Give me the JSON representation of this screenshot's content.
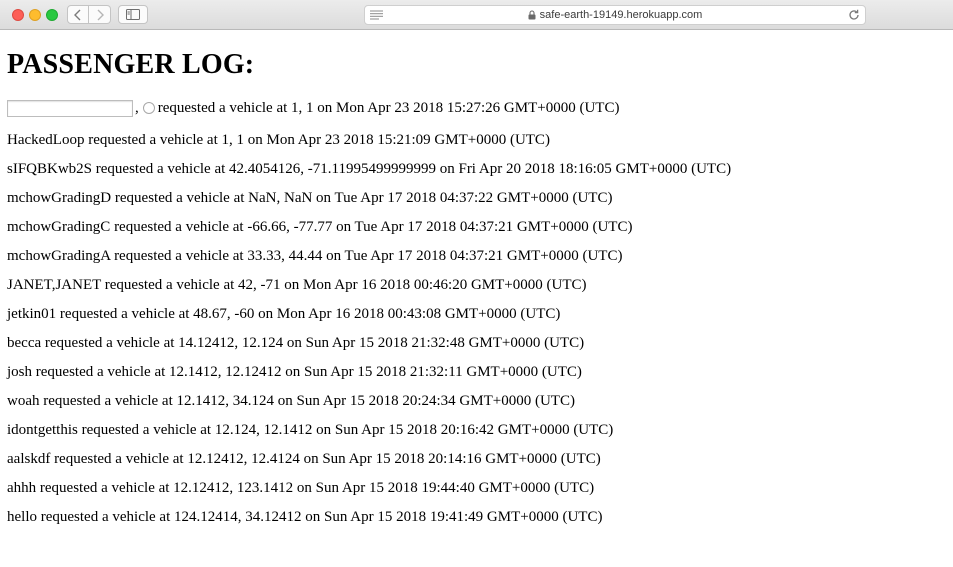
{
  "browser": {
    "url": "safe-earth-19149.herokuapp.com"
  },
  "page": {
    "title": "PASSENGER LOG:",
    "form": {
      "name_value": "",
      "comma": ",",
      "text": "requested a vehicle at 1, 1 on Mon Apr 23 2018 15:27:26 GMT+0000 (UTC)"
    },
    "entries": [
      "HackedLoop requested a vehicle at 1, 1 on Mon Apr 23 2018 15:21:09 GMT+0000 (UTC)",
      "sIFQBKwb2S requested a vehicle at 42.4054126, -71.11995499999999 on Fri Apr 20 2018 18:16:05 GMT+0000 (UTC)",
      "mchowGradingD requested a vehicle at NaN, NaN on Tue Apr 17 2018 04:37:22 GMT+0000 (UTC)",
      "mchowGradingC requested a vehicle at -66.66, -77.77 on Tue Apr 17 2018 04:37:21 GMT+0000 (UTC)",
      "mchowGradingA requested a vehicle at 33.33, 44.44 on Tue Apr 17 2018 04:37:21 GMT+0000 (UTC)",
      "JANET,JANET requested a vehicle at 42, -71 on Mon Apr 16 2018 00:46:20 GMT+0000 (UTC)",
      "jetkin01 requested a vehicle at 48.67, -60 on Mon Apr 16 2018 00:43:08 GMT+0000 (UTC)",
      "becca requested a vehicle at 14.12412, 12.124 on Sun Apr 15 2018 21:32:48 GMT+0000 (UTC)",
      "josh requested a vehicle at 12.1412, 12.12412 on Sun Apr 15 2018 21:32:11 GMT+0000 (UTC)",
      "woah requested a vehicle at 12.1412, 34.124 on Sun Apr 15 2018 20:24:34 GMT+0000 (UTC)",
      "idontgetthis requested a vehicle at 12.124, 12.1412 on Sun Apr 15 2018 20:16:42 GMT+0000 (UTC)",
      "aalskdf requested a vehicle at 12.12412, 12.4124 on Sun Apr 15 2018 20:14:16 GMT+0000 (UTC)",
      "ahhh requested a vehicle at 12.12412, 123.1412 on Sun Apr 15 2018 19:44:40 GMT+0000 (UTC)",
      "hello requested a vehicle at 124.12414, 34.12412 on Sun Apr 15 2018 19:41:49 GMT+0000 (UTC)"
    ]
  }
}
